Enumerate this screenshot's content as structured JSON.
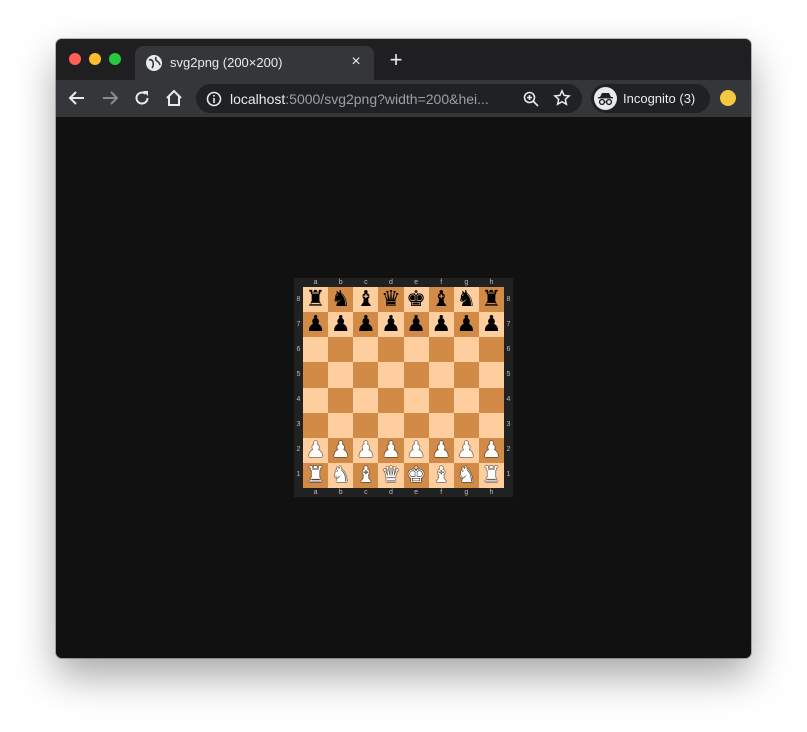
{
  "tab": {
    "title": "svg2png (200×200)",
    "icon": "globe-icon",
    "close": "×"
  },
  "new_tab": "+",
  "toolbar": {
    "url_host": "localhost",
    "url_rest": ":5000/svg2png?width=200&hei...",
    "profile_label": "Incognito (3)"
  },
  "colors": {
    "light_square": "#ffce9e",
    "dark_square": "#d18b47",
    "frame": "#212121",
    "page_background": "#111111"
  },
  "board": {
    "files": [
      "a",
      "b",
      "c",
      "d",
      "e",
      "f",
      "g",
      "h"
    ],
    "ranks": [
      "8",
      "7",
      "6",
      "5",
      "4",
      "3",
      "2",
      "1"
    ],
    "rows": [
      [
        "r",
        "n",
        "b",
        "q",
        "k",
        "b",
        "n",
        "r"
      ],
      [
        "p",
        "p",
        "p",
        "p",
        "p",
        "p",
        "p",
        "p"
      ],
      [
        "",
        "",
        "",
        "",
        "",
        "",
        "",
        ""
      ],
      [
        "",
        "",
        "",
        "",
        "",
        "",
        "",
        ""
      ],
      [
        "",
        "",
        "",
        "",
        "",
        "",
        "",
        ""
      ],
      [
        "",
        "",
        "",
        "",
        "",
        "",
        "",
        ""
      ],
      [
        "P",
        "P",
        "P",
        "P",
        "P",
        "P",
        "P",
        "P"
      ],
      [
        "R",
        "N",
        "B",
        "Q",
        "K",
        "B",
        "N",
        "R"
      ]
    ]
  }
}
